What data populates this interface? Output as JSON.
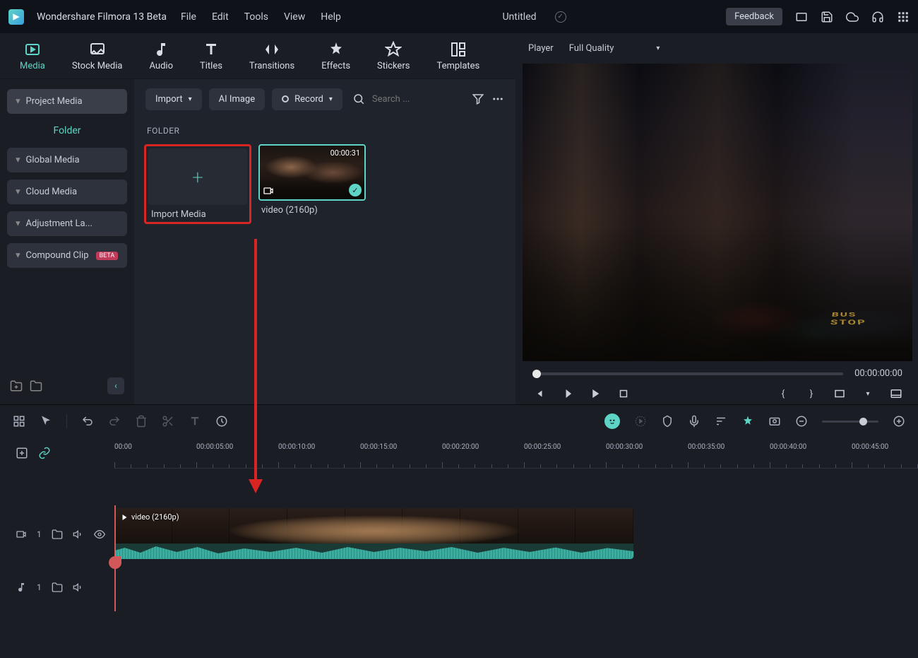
{
  "app": {
    "name": "Wondershare Filmora 13 Beta",
    "docTitle": "Untitled",
    "feedback": "Feedback"
  },
  "menus": {
    "file": "File",
    "edit": "Edit",
    "tools": "Tools",
    "view": "View",
    "help": "Help"
  },
  "tabs": {
    "media": "Media",
    "stock": "Stock Media",
    "audio": "Audio",
    "titles": "Titles",
    "transitions": "Transitions",
    "effects": "Effects",
    "stickers": "Stickers",
    "templates": "Templates"
  },
  "sidebar": {
    "project": "Project Media",
    "folder": "Folder",
    "global": "Global Media",
    "cloud": "Cloud Media",
    "adjustment": "Adjustment La...",
    "compound": "Compound Clip",
    "beta": "BETA"
  },
  "toolbar": {
    "import": "Import",
    "aiimage": "AI Image",
    "record": "Record",
    "search": "Search ..."
  },
  "media": {
    "folderHeader": "FOLDER",
    "importLabel": "Import Media",
    "clip1": {
      "duration": "00:00:31",
      "label": "video (2160p)"
    }
  },
  "player": {
    "label": "Player",
    "quality": "Full Quality",
    "timecode": "00:00:00:00",
    "busstop": "BUS\nSTOP"
  },
  "timeline": {
    "ticks": [
      "00:00",
      "00:00:05:00",
      "00:00:10:00",
      "00:00:15:00",
      "00:00:20:00",
      "00:00:25:00",
      "00:00:30:00",
      "00:00:35:00",
      "00:00:40:00",
      "00:00:45:00"
    ],
    "videoTrackNum": "1",
    "audioTrackNum": "1",
    "clipLabel": "video (2160p)"
  }
}
